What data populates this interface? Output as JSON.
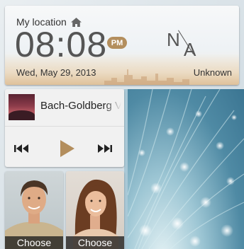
{
  "clock": {
    "location_label": "My location",
    "time": "08:08",
    "ampm": "PM",
    "date": "Wed, May 29, 2013",
    "temperature_n": "N",
    "temperature_a": "A",
    "condition": "Unknown"
  },
  "music": {
    "track_title": "Bach-Goldberg V",
    "controls": [
      "previous-icon",
      "play-icon",
      "next-icon"
    ]
  },
  "contacts": [
    {
      "action_label": "Choose"
    },
    {
      "action_label": "Choose"
    }
  ],
  "colors": {
    "ampm_badge": "#b38e5d",
    "play_button": "#b38e5d"
  }
}
